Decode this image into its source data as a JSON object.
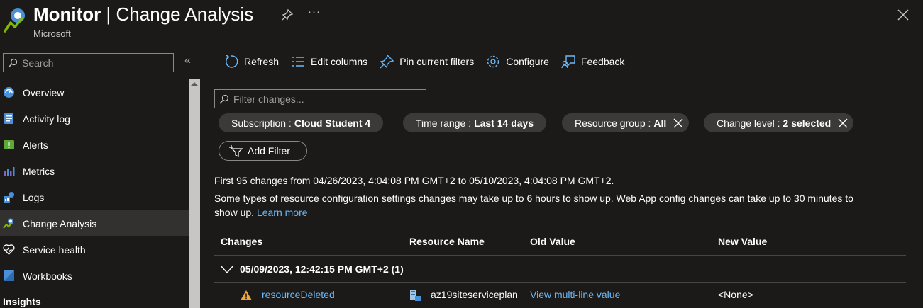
{
  "header": {
    "title_bold": "Monitor",
    "title_rest": " | Change Analysis",
    "subtitle": "Microsoft",
    "pin_icon": "pin-icon",
    "more_label": "···",
    "close_icon": "close-icon"
  },
  "sidebar": {
    "search_placeholder": "Search",
    "collapse_label": "«",
    "items": [
      {
        "label": "Overview",
        "icon": "overview-icon"
      },
      {
        "label": "Activity log",
        "icon": "activity-log-icon"
      },
      {
        "label": "Alerts",
        "icon": "alerts-icon"
      },
      {
        "label": "Metrics",
        "icon": "metrics-icon"
      },
      {
        "label": "Logs",
        "icon": "logs-icon"
      },
      {
        "label": "Change Analysis",
        "icon": "change-analysis-icon",
        "active": true
      },
      {
        "label": "Service health",
        "icon": "heart-icon"
      },
      {
        "label": "Workbooks",
        "icon": "workbooks-icon"
      }
    ],
    "section_heading": "Insights"
  },
  "toolbar": {
    "refresh": "Refresh",
    "edit_columns": "Edit columns",
    "pin_filters": "Pin current filters",
    "configure": "Configure",
    "feedback": "Feedback"
  },
  "filters": {
    "placeholder": "Filter changes...",
    "pills": [
      {
        "key": "Subscription :",
        "value": "Cloud Student 4",
        "removable": false
      },
      {
        "key": "Time range :",
        "value": "Last 14 days",
        "removable": false
      },
      {
        "key": "Resource group :",
        "value": "All",
        "removable": true
      },
      {
        "key": "Change level :",
        "value": "2 selected",
        "removable": true
      }
    ],
    "add_filter": "Add Filter"
  },
  "info": {
    "summary": "First 95 changes from 04/26/2023, 4:04:08 PM GMT+2 to 05/10/2023, 4:04:08 PM GMT+2.",
    "note_line1": "Some types of resource configuration settings changes may take up to 6 hours to show up. Web App config changes can take up to 30 minutes to",
    "note_line2": "show up.",
    "learn_more": "Learn more"
  },
  "grid": {
    "columns": [
      "Changes",
      "Resource Name",
      "Old Value",
      "New Value"
    ],
    "group": {
      "label": "05/09/2023, 12:42:15 PM GMT+2 (1)"
    },
    "rows": [
      {
        "change": "resourceDeleted",
        "resource": "az19siteserviceplan",
        "old_value": "View multi-line value",
        "new_value": "<None>"
      }
    ]
  },
  "colors": {
    "background": "#1b1a19",
    "link": "#6cb8f6",
    "pill": "#3b3a39",
    "active_nav": "#323130"
  }
}
